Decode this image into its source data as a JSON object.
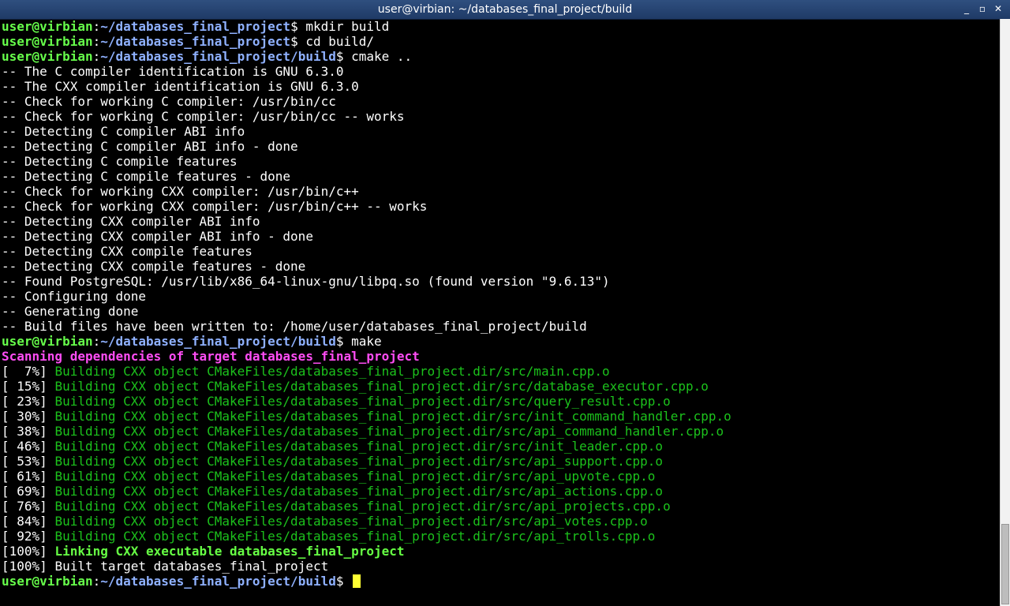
{
  "window": {
    "title": "user@virbian: ~/databases_final_project/build",
    "buttons": {
      "minimize": "_",
      "maximize": "▫",
      "close": "✕"
    }
  },
  "prompt": {
    "user_host": "user@virbian",
    "sep": ":",
    "path_root": "~/databases_final_project",
    "path_build": "~/databases_final_project/build",
    "symbol": "$ "
  },
  "lines": {
    "cmd1": "mkdir build",
    "cmd2": "cd build/",
    "cmd3": "cmake ..",
    "o1": "-- The C compiler identification is GNU 6.3.0",
    "o2": "-- The CXX compiler identification is GNU 6.3.0",
    "o3": "-- Check for working C compiler: /usr/bin/cc",
    "o4": "-- Check for working C compiler: /usr/bin/cc -- works",
    "o5": "-- Detecting C compiler ABI info",
    "o6": "-- Detecting C compiler ABI info - done",
    "o7": "-- Detecting C compile features",
    "o8": "-- Detecting C compile features - done",
    "o9": "-- Check for working CXX compiler: /usr/bin/c++",
    "o10": "-- Check for working CXX compiler: /usr/bin/c++ -- works",
    "o11": "-- Detecting CXX compiler ABI info",
    "o12": "-- Detecting CXX compiler ABI info - done",
    "o13": "-- Detecting CXX compile features",
    "o14": "-- Detecting CXX compile features - done",
    "o15": "-- Found PostgreSQL: /usr/lib/x86_64-linux-gnu/libpq.so (found version \"9.6.13\")",
    "o16": "-- Configuring done",
    "o17": "-- Generating done",
    "o18": "-- Build files have been written to: /home/user/databases_final_project/build",
    "cmd4": "make",
    "scan": "Scanning dependencies of target databases_final_project",
    "b1p": "[  7%] ",
    "b1": "Building CXX object CMakeFiles/databases_final_project.dir/src/main.cpp.o",
    "b2p": "[ 15%] ",
    "b2": "Building CXX object CMakeFiles/databases_final_project.dir/src/database_executor.cpp.o",
    "b3p": "[ 23%] ",
    "b3": "Building CXX object CMakeFiles/databases_final_project.dir/src/query_result.cpp.o",
    "b4p": "[ 30%] ",
    "b4": "Building CXX object CMakeFiles/databases_final_project.dir/src/init_command_handler.cpp.o",
    "b5p": "[ 38%] ",
    "b5": "Building CXX object CMakeFiles/databases_final_project.dir/src/api_command_handler.cpp.o",
    "b6p": "[ 46%] ",
    "b6": "Building CXX object CMakeFiles/databases_final_project.dir/src/init_leader.cpp.o",
    "b7p": "[ 53%] ",
    "b7": "Building CXX object CMakeFiles/databases_final_project.dir/src/api_support.cpp.o",
    "b8p": "[ 61%] ",
    "b8": "Building CXX object CMakeFiles/databases_final_project.dir/src/api_upvote.cpp.o",
    "b9p": "[ 69%] ",
    "b9": "Building CXX object CMakeFiles/databases_final_project.dir/src/api_actions.cpp.o",
    "b10p": "[ 76%] ",
    "b10": "Building CXX object CMakeFiles/databases_final_project.dir/src/api_projects.cpp.o",
    "b11p": "[ 84%] ",
    "b11": "Building CXX object CMakeFiles/databases_final_project.dir/src/api_votes.cpp.o",
    "b12p": "[ 92%] ",
    "b12": "Building CXX object CMakeFiles/databases_final_project.dir/src/api_trolls.cpp.o",
    "l1p": "[100%] ",
    "l1": "Linking CXX executable databases_final_project",
    "l2p": "[100%] ",
    "l2": "Built target databases_final_project"
  }
}
